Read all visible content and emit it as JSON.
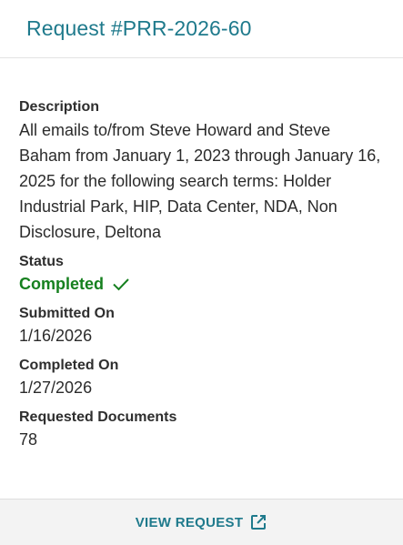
{
  "header": {
    "title": "Request #PRR-2026-60"
  },
  "details": {
    "description_label": "Description",
    "description_value": "All emails to/from Steve Howard and Steve Baham from January 1, 2023 through January 16, 2025 for the following search terms: Holder Industrial Park, HIP, Data Center, NDA, Non Disclosure, Deltona",
    "status_label": "Status",
    "status_value": "Completed",
    "submitted_label": "Submitted On",
    "submitted_value": "1/16/2026",
    "completed_label": "Completed On",
    "completed_value": "1/27/2026",
    "documents_label": "Requested Documents",
    "documents_value": "78"
  },
  "footer": {
    "view_label": "VIEW REQUEST"
  },
  "icons": {
    "status": "check-icon",
    "view": "external-link-icon"
  },
  "colors": {
    "accent": "#1f7a8c",
    "status_completed": "#16801f",
    "footer_bg": "#f3f3f3"
  }
}
